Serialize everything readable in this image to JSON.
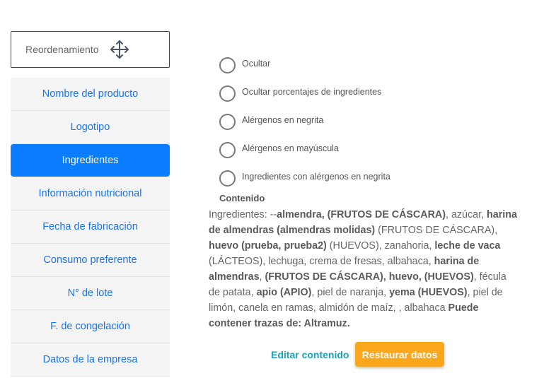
{
  "reorder": {
    "label": "Reordenamiento",
    "icon": "move-arrows-icon"
  },
  "sidebar": {
    "items": [
      {
        "label": "Nombre del producto",
        "active": false
      },
      {
        "label": "Logotipo",
        "active": false
      },
      {
        "label": "Ingredientes",
        "active": true
      },
      {
        "label": "Información nutricional",
        "active": false
      },
      {
        "label": "Fecha de fabricación",
        "active": false
      },
      {
        "label": "Consumo preferente",
        "active": false
      },
      {
        "label": "N° de lote",
        "active": false
      },
      {
        "label": "F. de congelación",
        "active": false
      },
      {
        "label": "Datos de la empresa",
        "active": false
      }
    ]
  },
  "options": [
    {
      "label": "Ocultar",
      "checked": false
    },
    {
      "label": "Ocultar porcentajes de ingredientes",
      "checked": false
    },
    {
      "label": "Alérgenos en negrita",
      "checked": false
    },
    {
      "label": "Alérgenos en mayúscula",
      "checked": false
    },
    {
      "label": "Ingredientes con alérgenos en negrita",
      "checked": false
    }
  ],
  "content": {
    "title": "Contenido",
    "segments": [
      {
        "t": "Ingredientes: --",
        "b": false
      },
      {
        "t": "almendra, (FRUTOS DE CÁSCARA)",
        "b": true
      },
      {
        "t": ", azúcar, ",
        "b": false
      },
      {
        "t": "harina de almendras (almendras molidas)",
        "b": true
      },
      {
        "t": " (FRUTOS DE CÁSCARA), ",
        "b": false
      },
      {
        "t": "huevo (prueba, prueba2)",
        "b": true
      },
      {
        "t": " (HUEVOS), zanahoria, ",
        "b": false
      },
      {
        "t": "leche de vaca",
        "b": true
      },
      {
        "t": " (LÁCTEOS), lechuga, crema de fresas, albahaca, ",
        "b": false
      },
      {
        "t": "harina de almendras",
        "b": true
      },
      {
        "t": ", ",
        "b": false
      },
      {
        "t": "(FRUTOS DE CÁSCARA), huevo, (HUEVOS)",
        "b": true
      },
      {
        "t": ", fécula de patata, ",
        "b": false
      },
      {
        "t": "apio (APIO)",
        "b": true
      },
      {
        "t": ", piel de naranja, ",
        "b": false
      },
      {
        "t": "yema (HUEVOS)",
        "b": true
      },
      {
        "t": ", piel de limón, canela en ramas, almidón de maíz, , albahaca ",
        "b": false
      },
      {
        "t": "Puede contener trazas de: Altramuz.",
        "b": true
      }
    ]
  },
  "actions": {
    "edit_label": "Editar contenido",
    "restore_label": "Restaurar datos"
  },
  "colors": {
    "active": "#0a7cff",
    "link": "#1a73e8",
    "edit": "#17a2b8",
    "restore": "#fba71b"
  }
}
